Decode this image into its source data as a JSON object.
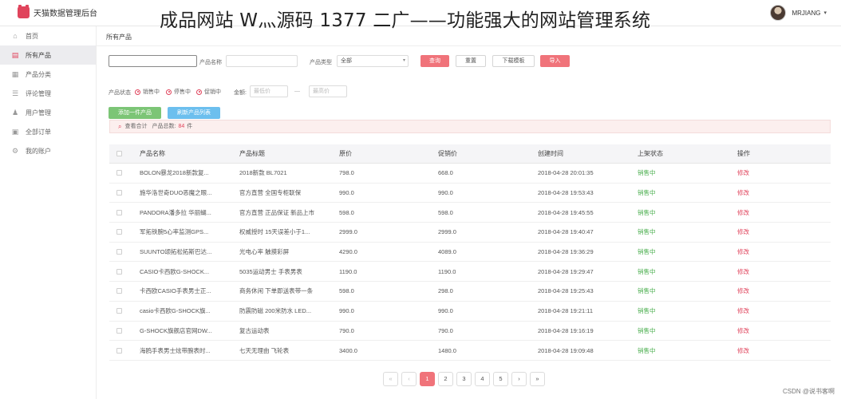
{
  "headline": "成品网站 W灬源码 1377 二广——功能强大的网站管理系统",
  "brand": {
    "name": "天猫数据管理后台"
  },
  "user": {
    "name": "MRJIANG",
    "caret": "▾"
  },
  "sidebar": {
    "items": [
      {
        "label": "首页",
        "icon": "⌂",
        "icon_name": "home-icon",
        "active": false
      },
      {
        "label": "所有产品",
        "icon": "▤",
        "icon_name": "product-list-icon",
        "active": true
      },
      {
        "label": "产品分类",
        "icon": "▦",
        "icon_name": "category-grid-icon",
        "active": false
      },
      {
        "label": "评论管理",
        "icon": "☰",
        "icon_name": "comment-list-icon",
        "active": false
      },
      {
        "label": "用户管理",
        "icon": "♟",
        "icon_name": "user-icon",
        "active": false
      },
      {
        "label": "全部订单",
        "icon": "▣",
        "icon_name": "orders-icon",
        "active": false
      },
      {
        "label": "我的账户",
        "icon": "⚙",
        "icon_name": "settings-gear-icon",
        "active": false
      }
    ]
  },
  "page_title": "所有产品",
  "filters": {
    "product_name_label": "产品名称",
    "product_type_label": "产品类型",
    "product_type_value": "全部",
    "search_button": "查询",
    "reset_button": "重置",
    "download_button": "下载模板",
    "import_button": "导入",
    "status_label": "产品状态",
    "status_options": [
      "销售中",
      "停售中",
      "促销中"
    ],
    "price_label": "金额:",
    "price_min_placeholder": "最低价",
    "price_separator": "—",
    "price_max_placeholder": "最高价"
  },
  "actions": {
    "add_button": "添加一件产品",
    "refresh_button": "刷新产品列表"
  },
  "summary": {
    "icon": "⌕",
    "lead": "查看合计",
    "total_label": "产品总数:",
    "total_count": "84",
    "unit": "件"
  },
  "table": {
    "headers": [
      "产品名称",
      "产品标题",
      "原价",
      "促销价",
      "创建时间",
      "上架状态",
      "操作"
    ],
    "rows": [
      {
        "name": "BOLON暴龙2018新款复...",
        "title": "2018新款 BL7021",
        "price": "798.0",
        "promo": "668.0",
        "created": "2018-04-28 20:01:35",
        "status": "销售中",
        "action": "修改"
      },
      {
        "name": "施华洛世奇DUO恶魔之眼...",
        "title": "官方直营 全国专柜联保",
        "price": "990.0",
        "promo": "990.0",
        "created": "2018-04-28 19:53:43",
        "status": "销售中",
        "action": "修改"
      },
      {
        "name": "PANDORA潘多拉 华丽蝴...",
        "title": "官方直营 正品保证 新品上市",
        "price": "598.0",
        "promo": "598.0",
        "created": "2018-04-28 19:45:55",
        "status": "销售中",
        "action": "修改"
      },
      {
        "name": "军拓铁腕5心率监测GPS...",
        "title": "权威授时 15天误差小于1...",
        "price": "2999.0",
        "promo": "2999.0",
        "created": "2018-04-28 19:40:47",
        "status": "销售中",
        "action": "修改"
      },
      {
        "name": "SUUNTO颂拓松拓斯巴达...",
        "title": "光电心率 触摸彩屏",
        "price": "4290.0",
        "promo": "4089.0",
        "created": "2018-04-28 19:36:29",
        "status": "销售中",
        "action": "修改"
      },
      {
        "name": "CASIO卡西欧G-SHOCK...",
        "title": "5035运动男士 手表男表",
        "price": "1190.0",
        "promo": "1190.0",
        "created": "2018-04-28 19:29:47",
        "status": "销售中",
        "action": "修改"
      },
      {
        "name": "卡西欧CASIO手表男士正...",
        "title": "商务休闲 下单即送表带一条",
        "price": "598.0",
        "promo": "298.0",
        "created": "2018-04-28 19:25:43",
        "status": "销售中",
        "action": "修改"
      },
      {
        "name": "casio卡西欧G-SHOCK旗...",
        "title": "防震防磁 200米防水 LED...",
        "price": "990.0",
        "promo": "990.0",
        "created": "2018-04-28 19:21:11",
        "status": "销售中",
        "action": "修改"
      },
      {
        "name": "G-SHOCK旗舰店官网DW...",
        "title": "复古运动表",
        "price": "790.0",
        "promo": "790.0",
        "created": "2018-04-28 19:16:19",
        "status": "销售中",
        "action": "修改"
      },
      {
        "name": "海鸥手表男士炫带腕表时...",
        "title": "七天无理由 飞轮表",
        "price": "3400.0",
        "promo": "1480.0",
        "created": "2018-04-28 19:09:48",
        "status": "销售中",
        "action": "修改"
      }
    ]
  },
  "pagination": {
    "first": "«",
    "prev": "‹",
    "pages": [
      "1",
      "2",
      "3",
      "4",
      "5"
    ],
    "current": "1",
    "next": "›",
    "last": "»"
  },
  "watermark": "CSDN @说书客啊",
  "colors": {
    "accent": "#e0445c",
    "button_red": "#f0737a",
    "button_green": "#7cc576",
    "button_blue": "#6cbfee",
    "status_green": "#4caf50"
  }
}
